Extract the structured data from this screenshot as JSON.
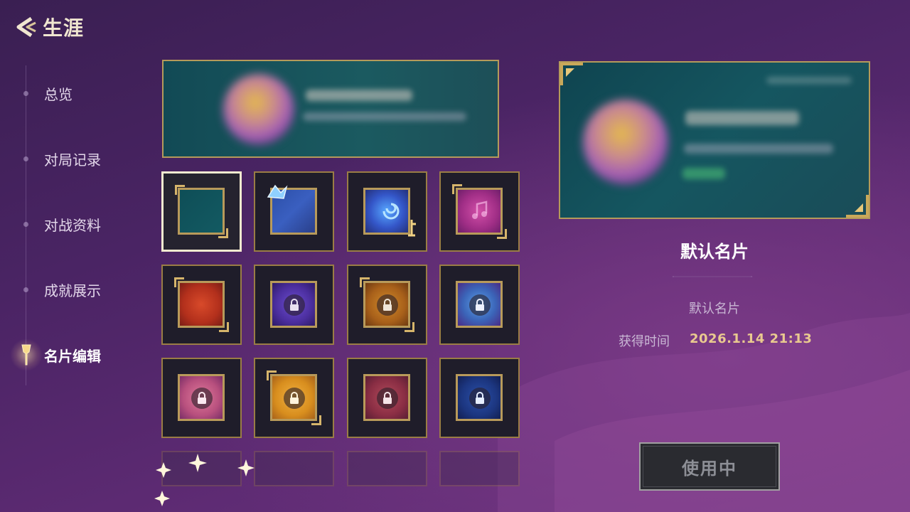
{
  "header": {
    "title": "生涯"
  },
  "sidebar": {
    "items": [
      {
        "label": "总览"
      },
      {
        "label": "对局记录"
      },
      {
        "label": "对战资料"
      },
      {
        "label": "成就展示"
      },
      {
        "label": "名片编辑",
        "active": true
      }
    ]
  },
  "cards": [
    {
      "theme": "teal",
      "locked": false,
      "selected": true
    },
    {
      "theme": "blue-crystal",
      "locked": false
    },
    {
      "theme": "cosmic-blue",
      "locked": false
    },
    {
      "theme": "magenta-music",
      "locked": false
    },
    {
      "theme": "red",
      "locked": false
    },
    {
      "theme": "violet",
      "locked": true
    },
    {
      "theme": "brown",
      "locked": true
    },
    {
      "theme": "blue-dragon",
      "locked": true
    },
    {
      "theme": "pink",
      "locked": true
    },
    {
      "theme": "gold",
      "locked": true
    },
    {
      "theme": "dark-red",
      "locked": true
    },
    {
      "theme": "deep-blue",
      "locked": true
    }
  ],
  "detail": {
    "name": "默认名片",
    "description": "默认名片",
    "obtain_label": "获得时间",
    "obtain_time": "2026.1.14  21:13"
  },
  "actions": {
    "use_label": "使用中"
  },
  "colors": {
    "gold_border": "#b59a5a",
    "accent": "#e9c98f",
    "teal": "#124a55"
  }
}
